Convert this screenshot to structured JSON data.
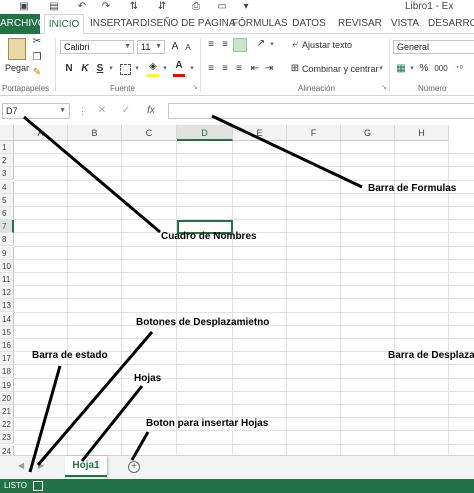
{
  "window": {
    "title": "Libro1 - Ex"
  },
  "tabs": [
    "ARCHIVO",
    "INICIO",
    "INSERTAR",
    "DISEÑO DE PÁGINA",
    "FÓRMULAS",
    "DATOS",
    "REVISAR",
    "VISTA",
    "DESARROL"
  ],
  "ribbon": {
    "paste_label": "Pegar",
    "font_name": "Calibri",
    "font_size": "11",
    "bold": "N",
    "italic": "K",
    "underline": "S",
    "wrap_text": "Ajustar texto",
    "merge_center": "Combinar y centrar",
    "number_format": "General",
    "percent": "%",
    "thousands": "000",
    "grow_font": "A",
    "shrink_font": "A",
    "groups": {
      "clipboard": "Portapapeles",
      "font": "Fuente",
      "alignment": "Alineación",
      "number": "Número"
    },
    "colors": {
      "fill": "#ffff00",
      "font": "#ff0000"
    }
  },
  "formula_bar": {
    "name_box": "D7",
    "fx": "fx",
    "cancel": "✕",
    "enter": "✓",
    "value": ""
  },
  "grid": {
    "columns": [
      "A",
      "B",
      "C",
      "D",
      "E",
      "F",
      "G",
      "H"
    ],
    "rows": [
      "1",
      "2",
      "3",
      "4",
      "5",
      "6",
      "7",
      "8",
      "9",
      "10",
      "11",
      "12",
      "13",
      "14",
      "15",
      "16",
      "17",
      "18",
      "19",
      "20",
      "21",
      "22",
      "23",
      "24"
    ],
    "selected_cell": "D7"
  },
  "sheets": {
    "active": "Hoja1",
    "add_icon": "+"
  },
  "status": {
    "text": "LISTO"
  },
  "annotations": {
    "formula_bar": "Barra de Formulas",
    "name_box": "Cuadro de Nombres",
    "scroll_buttons": "Botones de Desplazamietno",
    "status_bar": "Barra de estado",
    "scroll_bar": "Barra de Desplazam",
    "sheets": "Hojas",
    "insert_sheet": "Boton para insertar Hojas"
  },
  "theme": {
    "accent": "#217346"
  }
}
